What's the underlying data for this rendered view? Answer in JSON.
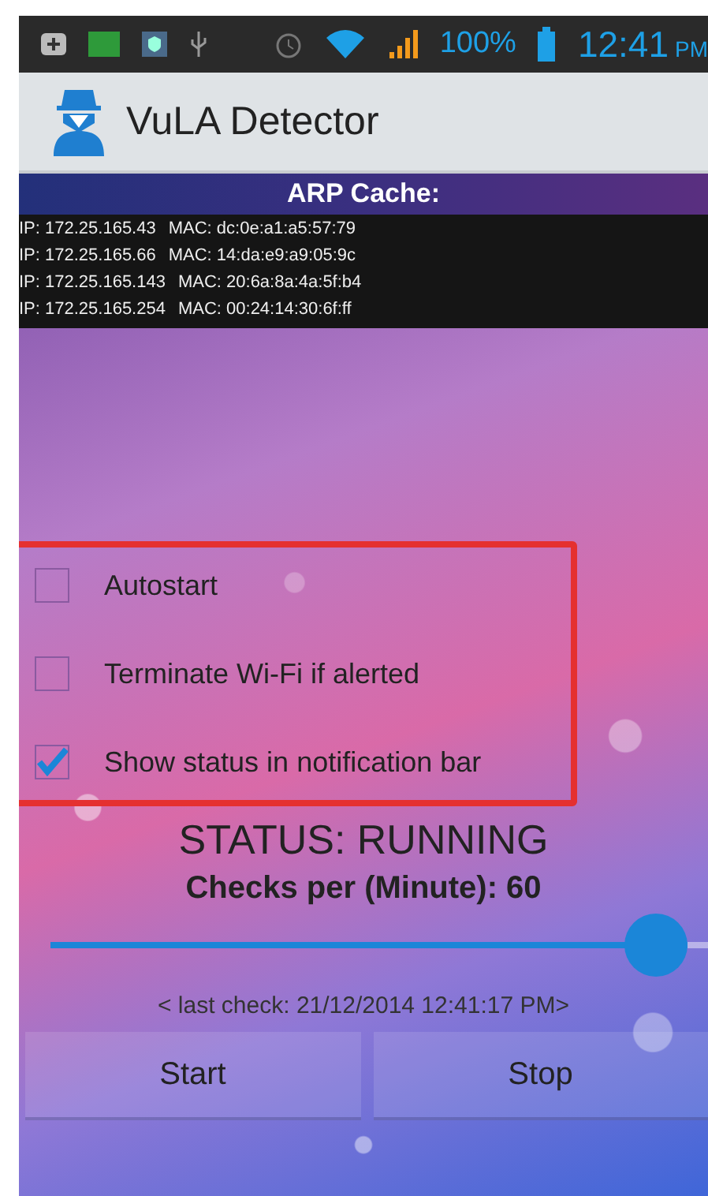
{
  "status_bar": {
    "battery": "100%",
    "time": "12:41",
    "meridiem": "PM"
  },
  "app_bar": {
    "title": "VuLA Detector"
  },
  "arp_cache": {
    "title": "ARP Cache:",
    "entries": [
      {
        "ip": "IP: 172.25.165.43",
        "mac": "MAC: dc:0e:a1:a5:57:79"
      },
      {
        "ip": "IP: 172.25.165.66",
        "mac": "MAC: 14:da:e9:a9:05:9c"
      },
      {
        "ip": "IP: 172.25.165.143",
        "mac": "MAC: 20:6a:8a:4a:5f:b4"
      },
      {
        "ip": "IP: 172.25.165.254",
        "mac": "MAC: 00:24:14:30:6f:ff"
      }
    ]
  },
  "options": [
    {
      "label": "Autostart",
      "checked": false
    },
    {
      "label": "Terminate Wi-Fi if alerted",
      "checked": false
    },
    {
      "label": "Show status in notification bar",
      "checked": true
    }
  ],
  "status": "STATUS: RUNNING",
  "checks_label": "Checks per (Minute): 60",
  "slider": {
    "level": 0.97
  },
  "last_check": "< last check: 21/12/2014 12:41:17 PM>",
  "buttons": [
    "Start",
    "Stop"
  ]
}
